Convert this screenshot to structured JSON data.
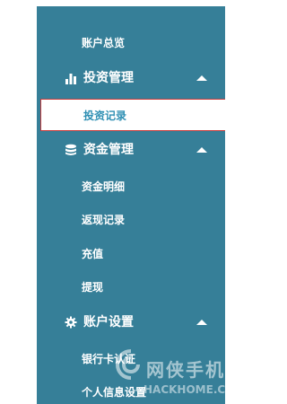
{
  "menu": {
    "account_overview": "账户总览",
    "investment": {
      "label": "投资管理",
      "icon": "bar-chart-icon",
      "items": [
        "投资记录"
      ]
    },
    "funds": {
      "label": "资金管理",
      "icon": "database-icon",
      "items": [
        "资金明细",
        "返现记录",
        "充值",
        "提现"
      ]
    },
    "account_settings": {
      "label": "账户设置",
      "icon": "gear-icon",
      "items": [
        "银行卡认证",
        "个人信息设置"
      ]
    }
  },
  "watermark": {
    "name": "网侠手机站",
    "domain": "HACKHOME.COM"
  },
  "colors": {
    "sidebar_bg": "#367f98",
    "active_text": "#2e8fb3",
    "active_border": "#c73b3b"
  }
}
